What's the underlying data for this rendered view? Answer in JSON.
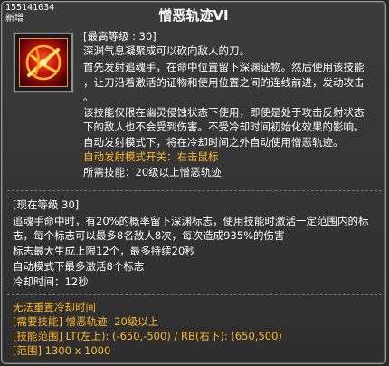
{
  "header": {
    "id_text": "155141034",
    "new_text": "新增",
    "title": "憎恶轨迹VI"
  },
  "icon": {
    "name": "hatred-trail-skill-icon"
  },
  "master": {
    "level_line": "[最高等级 : 30]",
    "desc": [
      "深渊气息凝聚成可以砍向敌人的刀。",
      "首先发射追魂手，在命中位置留下深渊证物。然后使用该技能",
      "，让刀沿着激活的证物和使用位置之间的连线前进，发动攻击",
      "。",
      "该技能仅限在幽灵侵蚀状态下使用，即使是处于攻击反射状态",
      "下的敌人也不会受到伤害。不受冷却时间初始化效果的影响。",
      "自动发射模式下，将在冷却时间之外自动使用憎恶轨迹。"
    ],
    "toggle_line": "自动发射模式开关：右击鼠标",
    "required_line": "所需技能：20级以上憎恶轨迹"
  },
  "current": {
    "level_line": "[现在等级 30]",
    "desc": [
      "追魂手命中时，有20%的概率留下深渊标志，使用技能时激活一定范围内的标",
      "志，每个标志可以最多8名敌人8次，每次造成935%的伤害",
      "标志最大生成上限12个，最多持续20秒",
      "自动模式下最多激活8个标志",
      "冷却时间：12秒"
    ]
  },
  "footer": {
    "no_reset": "无法重置冷却时间",
    "required": "[需要技能] 憎恶轨迹: 20级以上",
    "skill_point": "[技能范围] LT(左上): (-650,-500) / RB(右下): (650,500)",
    "range": "[范围] 1300 x 1000"
  },
  "colors": {
    "gold": "#ffb62e",
    "text": "#ffffff",
    "bg": "#333333"
  }
}
